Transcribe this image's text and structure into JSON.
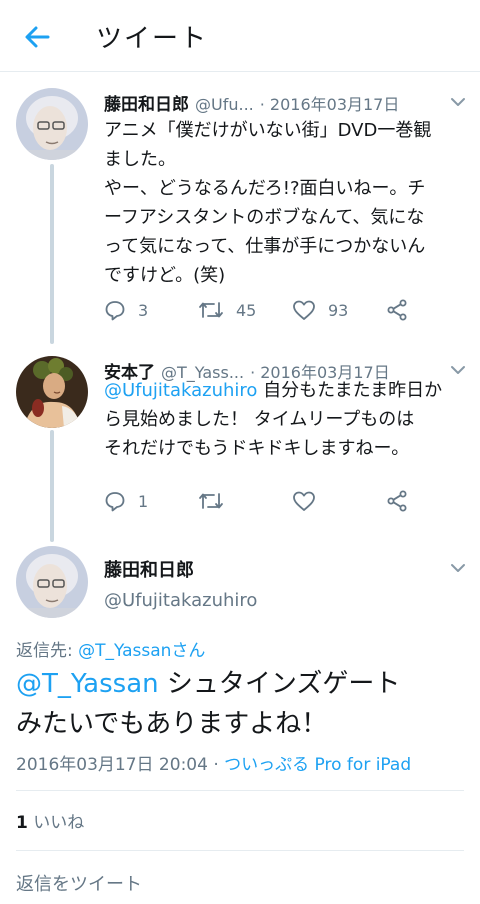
{
  "header": {
    "title": "ツイート"
  },
  "tweets": [
    {
      "name": "藤田和日郎",
      "handle": "@Ufu...",
      "date": "· 2016年03月17日",
      "lines": [
        "アニメ「僕だけがいない街」DVD一巻観",
        "ました。",
        "やー、どうなるんだろ!?面白いねー。チ",
        "ーフアシスタントのボブなんて、気にな",
        "って気になって、仕事が手につかないん",
        "ですけど。(笑)"
      ],
      "replies": "3",
      "retweets": "45",
      "likes": "93"
    },
    {
      "name": "安本了",
      "handle": "@T_Yass...",
      "date": "· 2016年03月17日",
      "mention": "@Ufujitakazuhiro",
      "line1_rest": " 自分もたまたま昨日か",
      "line2": "ら見始めました！ タイムリープものは",
      "line3": "それだけでもうドキドキしますねー。",
      "replies": "1",
      "retweets": "",
      "likes": ""
    }
  ],
  "focused": {
    "name": "藤田和日郎",
    "handle": "@Ufujitakazuhiro",
    "reply_to_label": "返信先: ",
    "reply_to_user": "@T_Yassanさん",
    "mention": "@T_Yassan",
    "text_rest": " シュタインズゲート",
    "text_line2": "みたいでもありますよね！",
    "datetime": "2016年03月17日 20:04",
    "sep": " · ",
    "source": "ついっぷる Pro for iPad",
    "like_count": "1",
    "like_label": " いいね",
    "reply_placeholder": "返信をツイート"
  }
}
